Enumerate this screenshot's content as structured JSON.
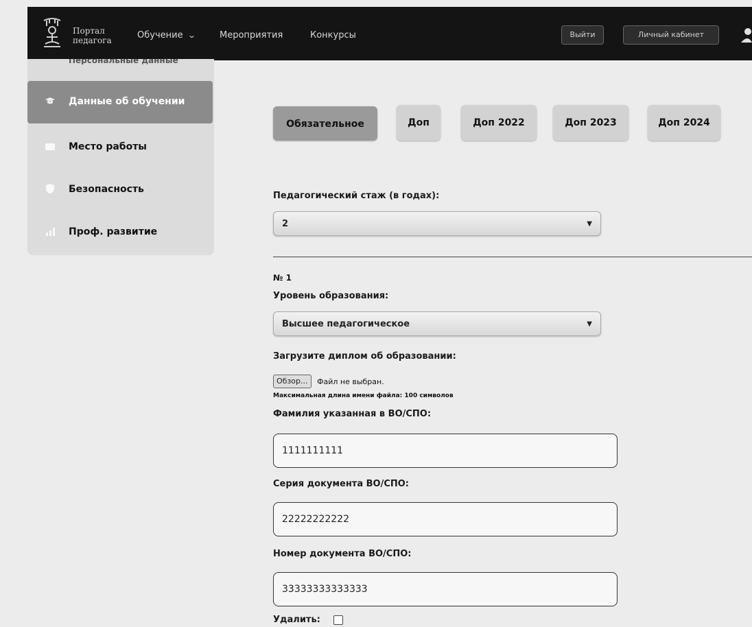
{
  "header": {
    "logo_line1": "Портал",
    "logo_line2": "педагога",
    "nav": [
      {
        "label": "Обучение"
      },
      {
        "label": "Мероприятия"
      },
      {
        "label": "Конкурсы"
      }
    ],
    "logout_label": "Выйти",
    "cabinet_label": "Личный кабинет"
  },
  "sidebar": {
    "cut_item": "Персональные данные",
    "items": [
      {
        "label": "Данные об обучении"
      },
      {
        "label": "Место работы"
      },
      {
        "label": "Безопасность"
      },
      {
        "label": "Проф. развитие"
      }
    ]
  },
  "tabs": [
    {
      "label": "Обязательное"
    },
    {
      "label": "Доп"
    },
    {
      "label": "Доп 2022"
    },
    {
      "label": "Доп 2023"
    },
    {
      "label": "Доп 2024"
    }
  ],
  "form": {
    "experience_label": "Педагогический стаж (в годах):",
    "experience_value": "2",
    "entry_number": "№ 1",
    "education_label": "Уровень образования:",
    "education_value": "Высшее педагогическое",
    "diploma_label": "Загрузите диплом об образовании:",
    "browse_label": "Обзор...",
    "file_status": "Файл не выбран.",
    "file_hint": "Максимальная длина имени файла: 100 символов",
    "surname_label": "Фамилия указанная в ВО/СПО:",
    "surname_value": "1111111111",
    "series_label": "Серия документа ВО/СПО:",
    "series_value": "22222222222",
    "number_label": "Номер документа ВО/СПО:",
    "number_value": "33333333333333",
    "delete_label": "Удалить:"
  }
}
